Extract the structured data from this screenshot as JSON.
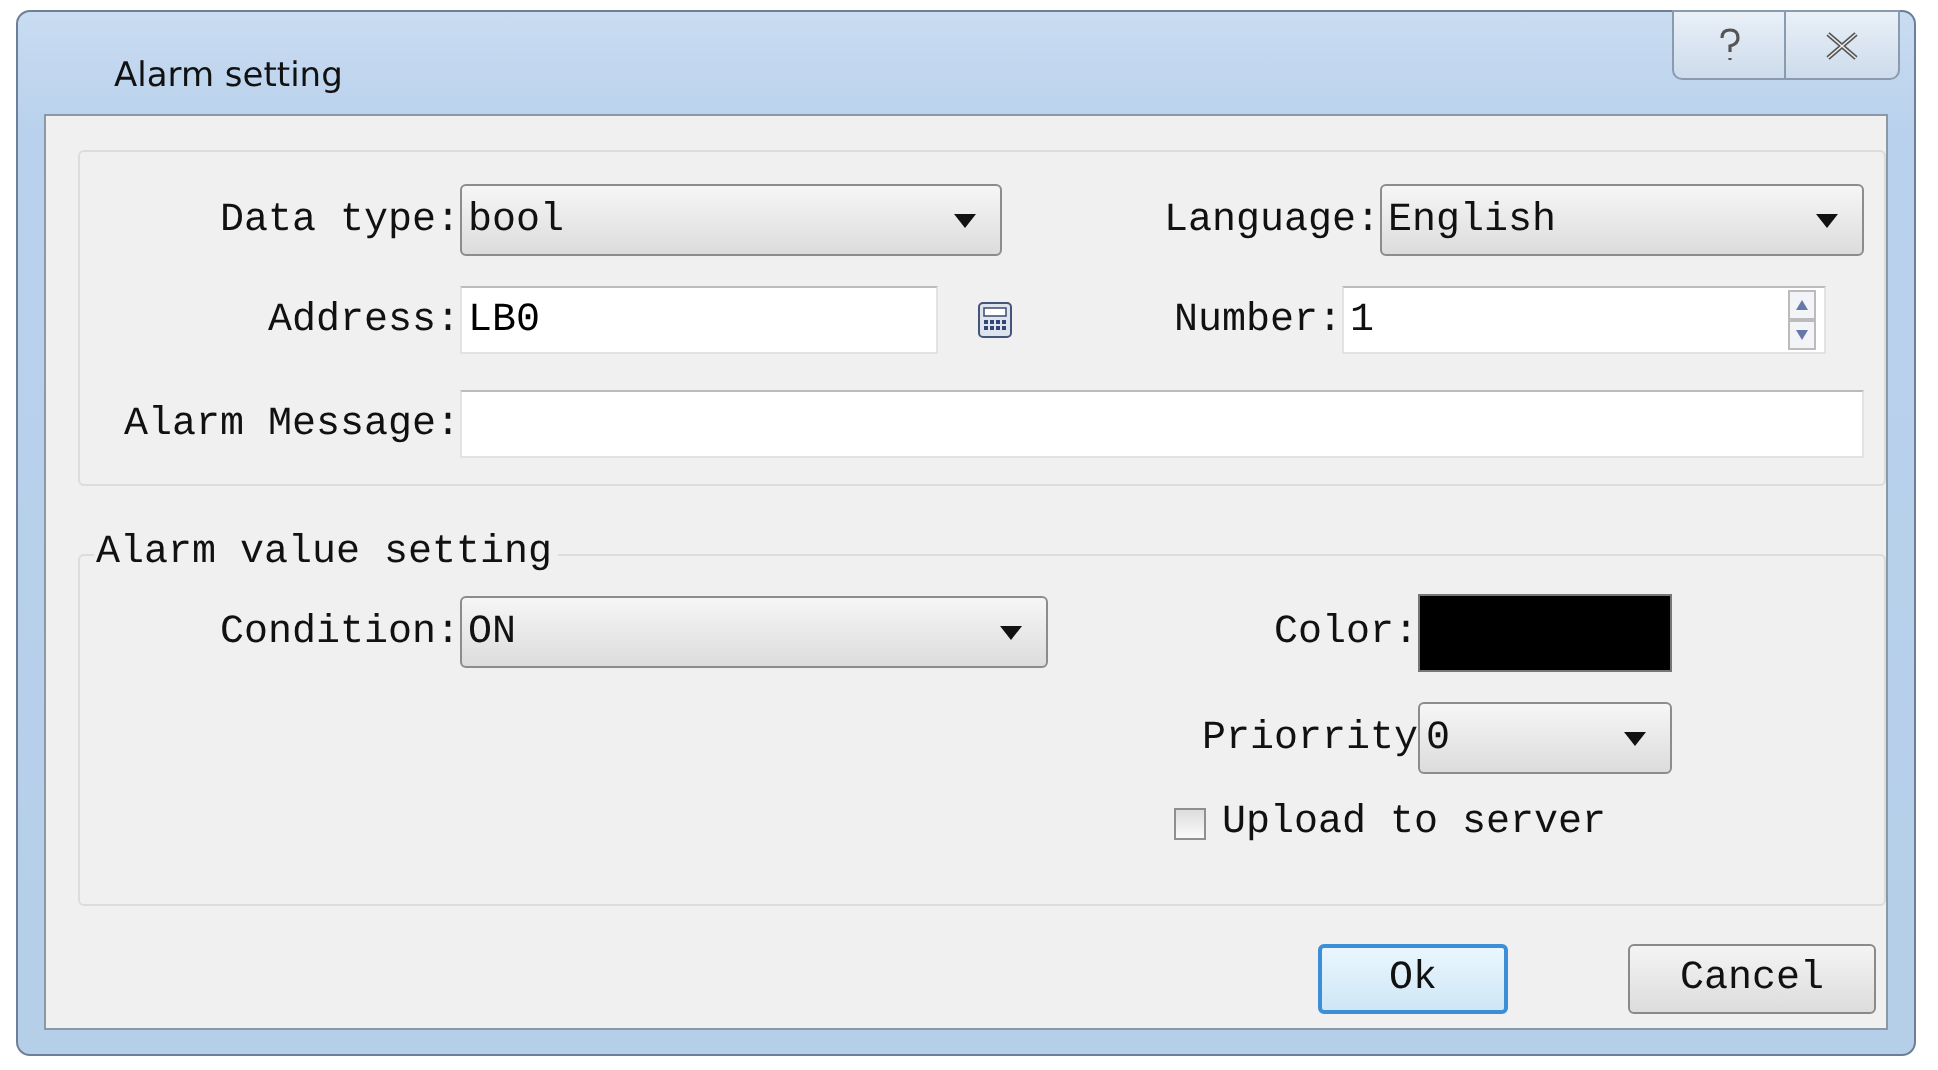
{
  "window": {
    "title": "Alarm setting"
  },
  "general": {
    "data_type": {
      "label": "Data type:",
      "value": "bool"
    },
    "language": {
      "label": "Language:",
      "value": "English"
    },
    "address": {
      "label": "Address:",
      "value": "LB0"
    },
    "number": {
      "label": "Number:",
      "value": "1"
    },
    "alarm_message": {
      "label": "Alarm Message:"
    }
  },
  "alarm_value_setting": {
    "title": "Alarm value setting",
    "condition": {
      "label": "Condition:",
      "value": "ON"
    },
    "color": {
      "label": "Color:",
      "color": "#000000"
    },
    "priority": {
      "label": "Priorrity",
      "value": "0"
    },
    "upload": {
      "label": "Upload to server",
      "checked": false
    }
  },
  "buttons": [
    {
      "label": "Ok",
      "default": true
    },
    {
      "label": "Cancel",
      "default": false
    }
  ]
}
